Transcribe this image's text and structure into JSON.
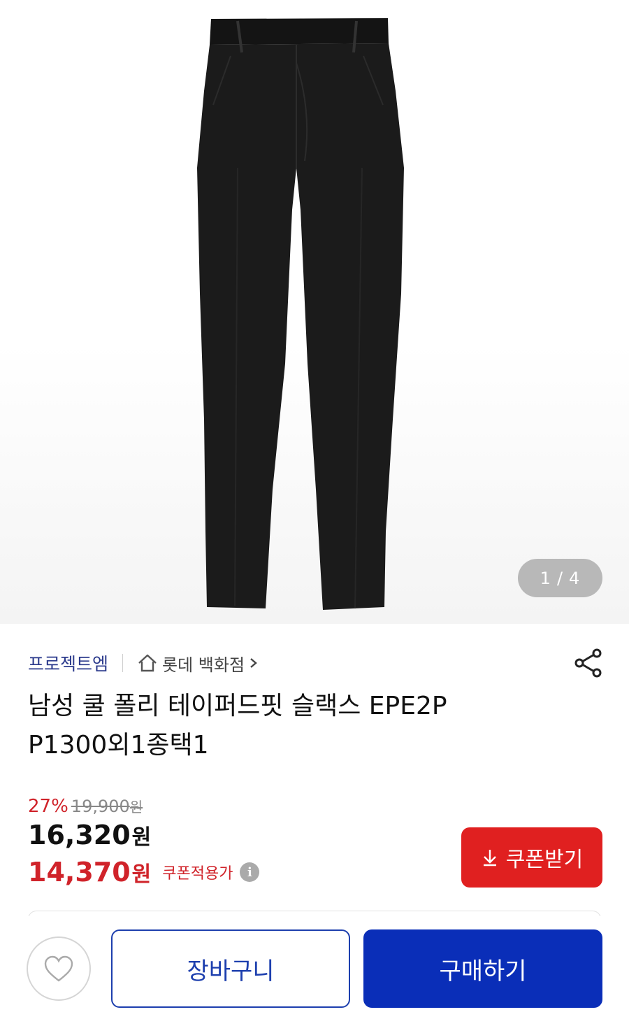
{
  "gallery": {
    "image_alt": "black slacks",
    "current": "1",
    "separator": "/",
    "total": "4"
  },
  "product": {
    "brand": "프로젝트엠",
    "store": "롯데 백화점",
    "title_line1": "남성 쿨 폴리 테이퍼드핏 슬랙스 EPE2P",
    "title_line2": "P1300외1종택1"
  },
  "price": {
    "discount_rate": "27%",
    "original": "19,900",
    "original_unit": "원",
    "sale": "16,320",
    "sale_unit": "원",
    "coupon_price": "14,370",
    "coupon_unit": "원",
    "coupon_note": "쿠폰적용가",
    "info_glyph": "i"
  },
  "buttons": {
    "coupon": "쿠폰받기",
    "cart": "장바구니",
    "buy": "구매하기"
  },
  "colors": {
    "brand_blue": "#2b3a8c",
    "accent_red": "#d0232a",
    "coupon_btn": "#e02020",
    "buy_blue": "#0a2eb8"
  },
  "icons": {
    "home": "home-icon",
    "chevron": "chevron-right-icon",
    "share": "share-icon",
    "download": "download-arrow-icon",
    "heart": "heart-icon",
    "info": "info-icon"
  }
}
